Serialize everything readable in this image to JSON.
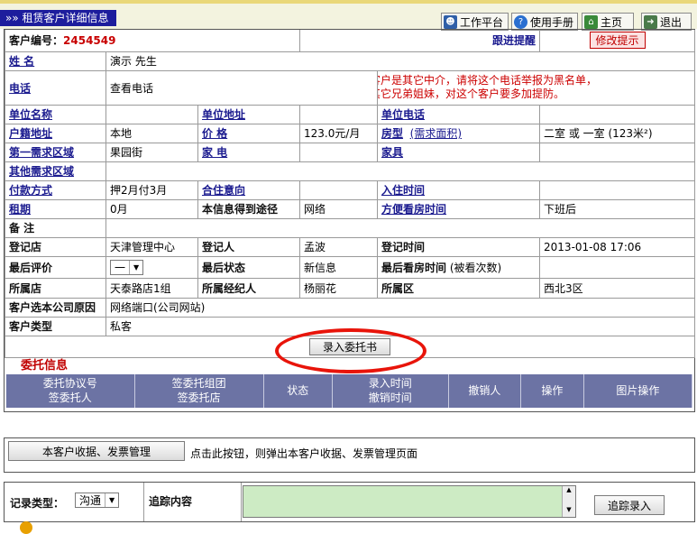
{
  "header": {
    "title": "»» 租赁客户详细信息",
    "buttons": [
      {
        "label": "工作平台",
        "icon": "person-icon"
      },
      {
        "label": "使用手册",
        "icon": "help-icon"
      },
      {
        "label": "主页",
        "icon": "home-icon"
      },
      {
        "label": "退出",
        "icon": "exit-icon"
      }
    ]
  },
  "customer": {
    "id_label": "客户编号：",
    "id_value": "2454549",
    "follow_reminder": "跟进提醒",
    "modify_prompt": "修改提示"
  },
  "rows": {
    "name_label": "姓 名",
    "name_value": "演示 先生",
    "phone_label": "电话",
    "phone_value": "查看电话",
    "warning_line1": "如果，你发现这个客户是其它中介，请将这个电话举报为黑名单，",
    "warning_line2": "就可以告诉我家的其它兄弟姐妹，对这个客户要多加提防。",
    "company_name_label": "单位名称",
    "company_addr_label": "单位地址",
    "company_phone_label": "单位电话",
    "hukou_label": "户籍地址",
    "hukou_value": "本地",
    "price_label": "价 格",
    "price_value": "123.0元/月",
    "layout_label": "房型",
    "area_label": "(需求面积)",
    "layout_value": "二室 或 一室 (123米²)",
    "area1_label": "第一需求区域",
    "area1_value": "果园街",
    "appliance_label": "家 电",
    "furniture_label": "家具",
    "other_area_label": "其他需求区域",
    "payment_label": "付款方式",
    "payment_value": "押2月付3月",
    "cotenant_label": "合住意向",
    "checkin_label": "入住时间",
    "lease_label": "租期",
    "lease_value": "0月",
    "source_label": "本信息得到途径",
    "source_value": "网络",
    "viewing_label": "方便看房时间",
    "viewing_value": "下班后",
    "note_label": "备 注",
    "reg_store_label": "登记店",
    "reg_store_value": "天津管理中心",
    "reg_person_label": "登记人",
    "reg_person_value": "孟波",
    "reg_time_label": "登记时间",
    "reg_time_value": "2013-01-08 17:06",
    "last_eval_label": "最后评价",
    "last_eval_value": "一",
    "last_status_label": "最后状态",
    "last_status_value": "新信息",
    "last_view_label": "最后看房时间",
    "last_view_count": "(被看次数)",
    "store_label": "所属店",
    "store_value": "天泰路店1组",
    "agent_label": "所属经纪人",
    "agent_value": "杨丽花",
    "district_label": "所属区",
    "district_value": "西北3区",
    "reason_label": "客户选本公司原因",
    "reason_value": "网络端口(公司网站)",
    "type_label": "客户类型",
    "type_value": "私客"
  },
  "enter_button": "录入委托书",
  "commission": {
    "title": "委托信息",
    "columns": [
      {
        "l1": "委托协议号",
        "l2": "签委托人"
      },
      {
        "l1": "签委托组团",
        "l2": "签委托店"
      },
      {
        "l1": "状态",
        "l2": ""
      },
      {
        "l1": "录入时间",
        "l2": "撤销时间"
      },
      {
        "l1": "撤销人",
        "l2": ""
      },
      {
        "l1": "操作",
        "l2": ""
      },
      {
        "l1": "图片操作",
        "l2": ""
      }
    ]
  },
  "receipt": {
    "button": "本客户收据、发票管理",
    "hint": "点击此按钮，则弹出本客户收据、发票管理页面"
  },
  "tracking": {
    "type_label": "记录类型：",
    "type_value": "沟通",
    "content_label": "追踪内容",
    "content_value": "",
    "submit": "追踪录入"
  },
  "colors": {
    "title_bg": "#1d1d9d",
    "header_bg": "#6c73a4",
    "highlight": "#cc0000",
    "textarea_bg": "#cdebc4",
    "annotation": "#e8140a"
  }
}
